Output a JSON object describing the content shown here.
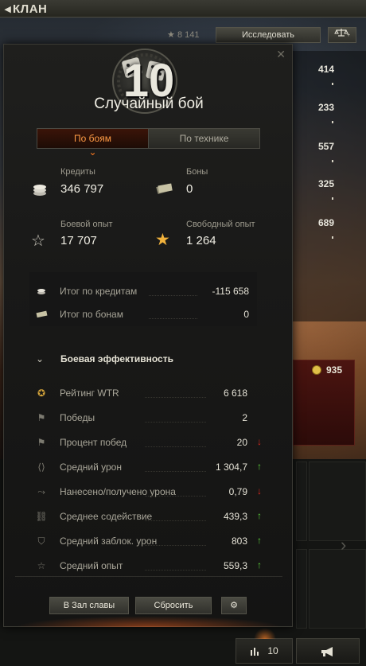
{
  "window": {
    "title": "КЛАН"
  },
  "header": {
    "xp_value": "8 141",
    "research_label": "Исследовать"
  },
  "right_stats": [
    "414",
    "233",
    "557",
    "325",
    "689"
  ],
  "gold": {
    "value": "935"
  },
  "bottom_bar": {
    "hall_count": "10"
  },
  "popup": {
    "tier": "10",
    "battle_type": "Случайный бой",
    "tabs": [
      {
        "label": "По боям",
        "active": true
      },
      {
        "label": "По технике",
        "active": false
      }
    ],
    "credits": {
      "label": "Кредиты",
      "value": "346 797"
    },
    "bonds": {
      "label": "Боны",
      "value": "0"
    },
    "combat_xp": {
      "label": "Боевой опыт",
      "value": "17 707"
    },
    "free_xp": {
      "label": "Свободный опыт",
      "value": "1 264"
    },
    "summary": [
      {
        "label": "Итог по кредитам",
        "value": "-115 658"
      },
      {
        "label": "Итог по бонам",
        "value": "0"
      }
    ],
    "efficiency_title": "Боевая эффективность",
    "efficiency": [
      {
        "label": "Рейтинг WTR",
        "value": "6 618",
        "trend": "",
        "icon": "wtr-icon"
      },
      {
        "label": "Победы",
        "value": "2",
        "trend": "",
        "icon": "flag-icon"
      },
      {
        "label": "Процент побед",
        "value": "20",
        "trend": "down",
        "icon": "flag-icon"
      },
      {
        "label": "Средний урон",
        "value": "1 304,7",
        "trend": "up",
        "icon": "damage-icon"
      },
      {
        "label": "Нанесено/получено урона",
        "value": "0,79",
        "trend": "down",
        "icon": "ratio-icon"
      },
      {
        "label": "Среднее содействие",
        "value": "439,3",
        "trend": "up",
        "icon": "assist-icon"
      },
      {
        "label": "Средний заблок. урон",
        "value": "803",
        "trend": "up",
        "icon": "blocked-icon"
      },
      {
        "label": "Средний опыт",
        "value": "559,3",
        "trend": "up",
        "icon": "xp-icon"
      }
    ],
    "buttons": {
      "hall_of_fame": "В Зал славы",
      "reset": "Сбросить"
    }
  },
  "colors": {
    "accent_orange": "#ff9b45",
    "trend_up": "#5bd13a",
    "trend_down": "#e0281f"
  }
}
